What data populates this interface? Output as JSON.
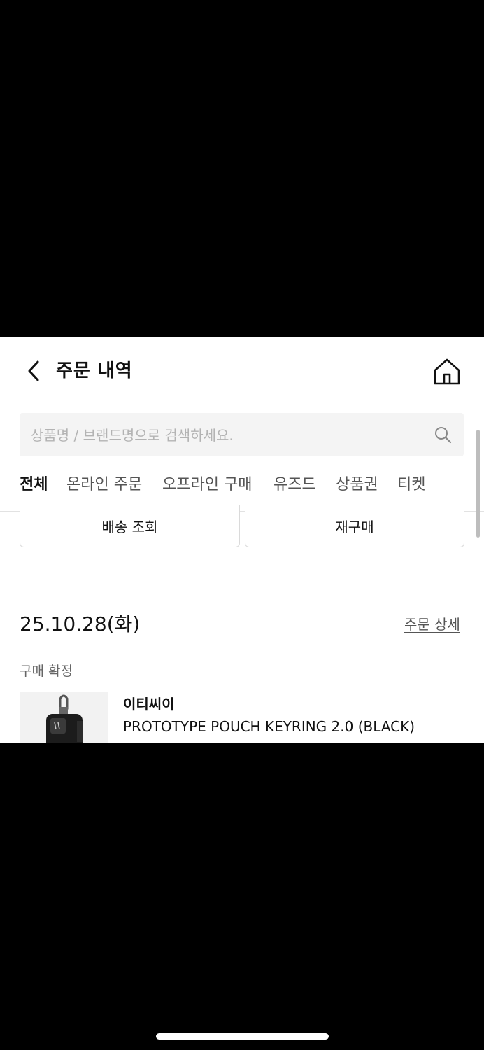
{
  "header": {
    "title": "주문 내역",
    "back_icon": "chevron-left-icon",
    "home_icon": "home-icon"
  },
  "search": {
    "placeholder": "상품명 / 브랜드명으로 검색하세요.",
    "value": "",
    "icon": "search-icon"
  },
  "tabs": [
    {
      "label": "전체",
      "active": true
    },
    {
      "label": "온라인 주문",
      "active": false
    },
    {
      "label": "오프라인 구매",
      "active": false
    },
    {
      "label": "유즈드",
      "active": false
    },
    {
      "label": "상품권",
      "active": false
    },
    {
      "label": "티켓",
      "active": false
    }
  ],
  "actions": {
    "delivery_label": "배송 조회",
    "reorder_label": "재구매"
  },
  "order": {
    "date": "25.10.28(화)",
    "detail_link": "주문 상세",
    "status": "구매 확정",
    "item": {
      "brand": "이티씨이",
      "name": "PROTOTYPE POUCH KEYRING 2.0 (BLACK)"
    }
  },
  "colors": {
    "background": "#000000",
    "surface": "#ffffff",
    "text": "#111111",
    "muted": "#666666",
    "placeholder": "#b3b3b3",
    "search_bg": "#f4f4f4"
  }
}
